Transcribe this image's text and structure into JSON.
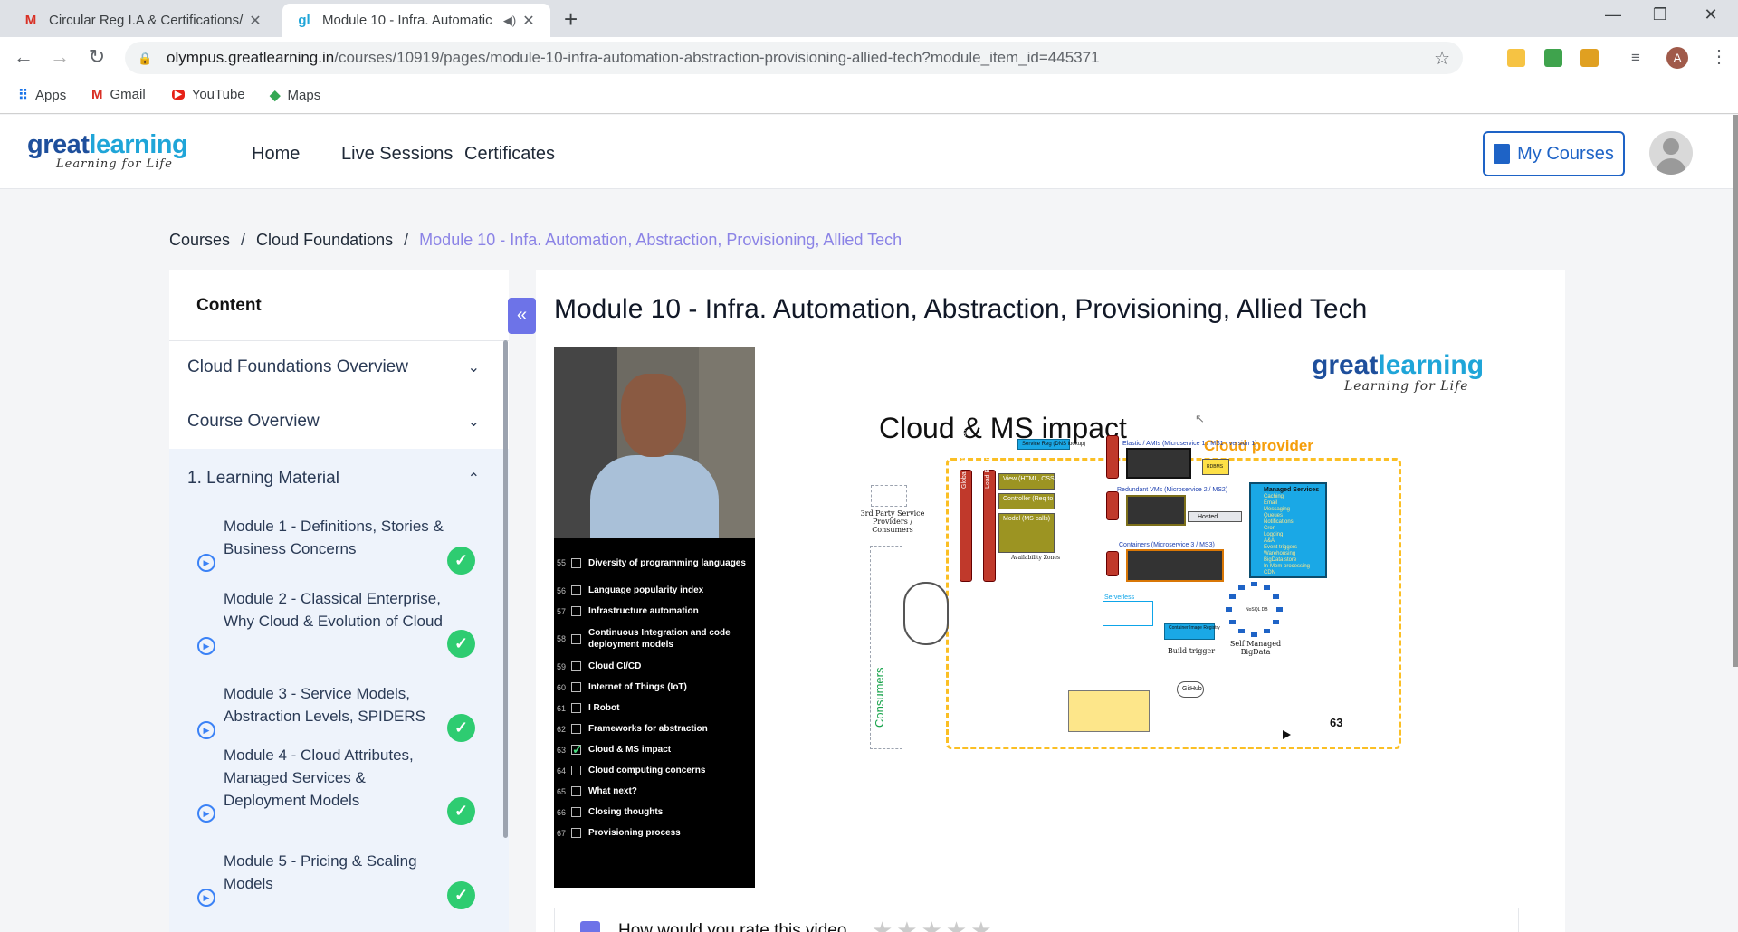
{
  "browser": {
    "tabs": [
      {
        "label": "Circular Reg I.A & Certifications/",
        "favicon": "M",
        "active": false
      },
      {
        "label": "Module 10 - Infra. Automatic",
        "favicon": "gl",
        "active": true
      }
    ],
    "url_host": "olympus.greatlearning.in",
    "url_path": "/courses/10919/pages/module-10-infra-automation-abstraction-provisioning-allied-tech?module_item_id=445371",
    "profile_initial": "A",
    "bookmarks": [
      {
        "label": "Apps",
        "icon": "apps-grid-icon"
      },
      {
        "label": "Gmail",
        "icon": "gmail-icon"
      },
      {
        "label": "YouTube",
        "icon": "youtube-icon"
      },
      {
        "label": "Maps",
        "icon": "maps-icon"
      }
    ]
  },
  "site": {
    "logo_a": "great",
    "logo_b": "learning",
    "logo_tagline": "Learning for Life",
    "nav": [
      "Home",
      "Live Sessions",
      "Certificates"
    ],
    "my_courses": "My Courses"
  },
  "breadcrumb": {
    "items": [
      "Courses",
      "Cloud Foundations"
    ],
    "separator": "/",
    "current": "Module 10 - Infa. Automation, Abstraction, Provisioning, Allied Tech"
  },
  "sidebar": {
    "title": "Content",
    "sections": [
      "Cloud Foundations Overview",
      "Course Overview",
      "1. Learning Material"
    ],
    "modules": [
      "Module 1 - Definitions, Stories & Business Concerns",
      "Module 2 - Classical Enterprise, Why Cloud & Evolution of Cloud",
      "Module 3 - Service Models, Abstraction Levels, SPIDERS",
      "Module 4 - Cloud Attributes, Managed Services & Deployment Models",
      "Module 5 - Pricing & Scaling Models"
    ]
  },
  "main": {
    "title": "Module 10 - Infra. Automation, Abstraction, Provisioning, Allied Tech",
    "rating_question": "How would you rate this video",
    "rating_stars": "★★★★★"
  },
  "video": {
    "toc": [
      {
        "n": "55",
        "t": "Diversity of programming languages",
        "done": false
      },
      {
        "n": "56",
        "t": "Language popularity index",
        "done": false
      },
      {
        "n": "57",
        "t": "Infrastructure automation",
        "done": false
      },
      {
        "n": "58",
        "t": "Continuous Integration and code deployment models",
        "done": false
      },
      {
        "n": "59",
        "t": "Cloud CI/CD",
        "done": false
      },
      {
        "n": "60",
        "t": "Internet of Things (IoT)",
        "done": false
      },
      {
        "n": "61",
        "t": "I Robot",
        "done": false
      },
      {
        "n": "62",
        "t": "Frameworks for abstraction",
        "done": false
      },
      {
        "n": "63",
        "t": "Cloud & MS impact",
        "done": true
      },
      {
        "n": "64",
        "t": "Cloud computing concerns",
        "done": false
      },
      {
        "n": "65",
        "t": "What next?",
        "done": false
      },
      {
        "n": "66",
        "t": "Closing thoughts",
        "done": false
      },
      {
        "n": "67",
        "t": "Provisioning process",
        "done": false
      }
    ],
    "slide": {
      "title": "Cloud & MS impact",
      "provider_label": "Cloud provider",
      "third_party": "3rd Party Service Providers / Consumers",
      "consumers": "Consumers",
      "service_reg": "Service Reg (DNS lookup)",
      "elastic": "Elastic / AMIs (Microservice 1 / MS1 - version 1)",
      "redundant": "Redundant VMs (Microservice 2 / MS2)",
      "containers": "Containers (Microservice 3 / MS3)",
      "hosted": "Hosted",
      "rdbms": "RDBMS",
      "serverless": "Serverless",
      "container_registry": "Container Image Registry",
      "build_trigger": "Build trigger",
      "self_managed": "Self Managed BigData",
      "nosql": "NoSQL DB",
      "github": "GitHub",
      "managed_title": "Managed Services",
      "managed_items": [
        "Caching",
        "Email",
        "Messaging",
        "Queues",
        "Notifications",
        "Cron",
        "Logging",
        "A&A",
        "Event triggers",
        "Warehousing",
        "BigData store",
        "In-Mem processing",
        "CDN"
      ],
      "view": "View (HTML, CSS, JS, Img, UI Libs)",
      "controller": "Controller (Req to model routing)",
      "model": "Model (MS calls)",
      "availability": "Availability Zones",
      "global_dns": "Global DNS / Region",
      "load_balancer": "Load Balancer / AZ",
      "page": "63",
      "accent_orange": "#fbbf24",
      "accent_cyan": "#1aa8e6"
    }
  },
  "colors": {
    "brand_blue": "#1e63c6",
    "breadcrumb_current": "#8b83e6",
    "complete_green": "#2ecc71",
    "collapse_button": "#6d73e8"
  }
}
